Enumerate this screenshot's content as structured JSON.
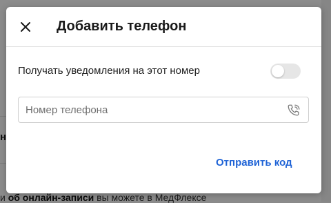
{
  "background": {
    "bold_fragment": "ни",
    "footer_prefix": "и ",
    "footer_bold": "об онлайн-записи",
    "footer_rest": " вы можете в МедФлексе"
  },
  "modal": {
    "title": "Добавить телефон",
    "close_icon": "close-icon",
    "notifications_label": "Получать уведомления на этот номер",
    "notifications_enabled": false,
    "phone_placeholder": "Номер телефона",
    "phone_value": "",
    "phone_icon": "phone-icon",
    "send_code_label": "Отправить код"
  },
  "colors": {
    "accent": "#1f63d6",
    "toggle_off": "#e6e6e6",
    "title": "#1a1a1a"
  }
}
